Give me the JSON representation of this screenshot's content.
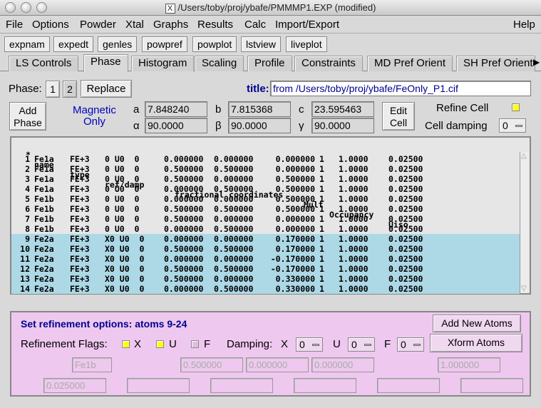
{
  "window": {
    "title": "/Users/toby/proj/ybafe/PMMMP1.EXP (modified)",
    "x_glyph": "X"
  },
  "menubar": {
    "items": [
      "File",
      "Options",
      "Powder",
      "Xtal",
      "Graphs",
      "Results",
      "Calc",
      "Import/Export"
    ],
    "help": "Help"
  },
  "commands": [
    "expnam",
    "expedt",
    "genles",
    "powpref",
    "powplot",
    "lstview",
    "liveplot"
  ],
  "tabs": [
    "LS Controls",
    "Phase",
    "Histogram",
    "Scaling",
    "Profile",
    "Constraints",
    "MD Pref Orient",
    "SH Pref Orient"
  ],
  "active_tab": "Phase",
  "phase": {
    "label": "Phase:",
    "buttons": [
      "1",
      "2"
    ],
    "replace": "Replace",
    "title_label": "title:",
    "title_value": "from /Users/toby/proj/ybafe/FeOnly_P1.cif",
    "add_phase": "Add\nPhase",
    "magnetic": "Magnetic\nOnly",
    "cell": {
      "a_label": "a",
      "a": "7.848240",
      "b_label": "b",
      "b": "7.815368",
      "c_label": "c",
      "c": "23.595463",
      "alpha_label": "α",
      "alpha": "90.0000",
      "beta_label": "β",
      "beta": "90.0000",
      "gamma_label": "γ",
      "gamma": "90.0000"
    },
    "edit_cell": "Edit\nCell",
    "refine_cell": "Refine Cell",
    "cell_damping": "Cell damping",
    "cell_damping_value": "0"
  },
  "atom_table": {
    "headers": {
      "star": "*",
      "name": "name",
      "type": "type",
      "ref": "ref/damp",
      "coords": "fractional coordinates",
      "mult": "Mult",
      "occ": "Occupancy",
      "uiso": "Uiso"
    },
    "rows": [
      {
        "n": "1",
        "name": "Fe1a",
        "type": "FE+3",
        "ref": "0 U0  0",
        "x": "0.000000",
        "y": "0.000000",
        "z": "0.000000",
        "mult": "1",
        "occ": "1.0000",
        "uiso": "0.02500",
        "sel": false
      },
      {
        "n": "2",
        "name": "Fe1a",
        "type": "FE+3",
        "ref": "0 U0  0",
        "x": "0.500000",
        "y": "0.500000",
        "z": "0.000000",
        "mult": "1",
        "occ": "1.0000",
        "uiso": "0.02500",
        "sel": false
      },
      {
        "n": "3",
        "name": "Fe1a",
        "type": "FE+3",
        "ref": "0 U0  0",
        "x": "0.500000",
        "y": "0.000000",
        "z": "0.500000",
        "mult": "1",
        "occ": "1.0000",
        "uiso": "0.02500",
        "sel": false
      },
      {
        "n": "4",
        "name": "Fe1a",
        "type": "FE+3",
        "ref": "0 U0  0",
        "x": "0.000000",
        "y": "0.500000",
        "z": "0.500000",
        "mult": "1",
        "occ": "1.0000",
        "uiso": "0.02500",
        "sel": false
      },
      {
        "n": "5",
        "name": "Fe1b",
        "type": "FE+3",
        "ref": "0 U0  0",
        "x": "0.000000",
        "y": "0.000000",
        "z": "0.500000",
        "mult": "1",
        "occ": "1.0000",
        "uiso": "0.02500",
        "sel": false
      },
      {
        "n": "6",
        "name": "Fe1b",
        "type": "FE+3",
        "ref": "0 U0  0",
        "x": "0.500000",
        "y": "0.500000",
        "z": "0.500000",
        "mult": "1",
        "occ": "1.0000",
        "uiso": "0.02500",
        "sel": false
      },
      {
        "n": "7",
        "name": "Fe1b",
        "type": "FE+3",
        "ref": "0 U0  0",
        "x": "0.500000",
        "y": "0.000000",
        "z": "0.000000",
        "mult": "1",
        "occ": "1.0000",
        "uiso": "0.02500",
        "sel": false
      },
      {
        "n": "8",
        "name": "Fe1b",
        "type": "FE+3",
        "ref": "0 U0  0",
        "x": "0.000000",
        "y": "0.500000",
        "z": "0.000000",
        "mult": "1",
        "occ": "1.0000",
        "uiso": "0.02500",
        "sel": false
      },
      {
        "n": "9",
        "name": "Fe2a",
        "type": "FE+3",
        "ref": "X0 U0  0",
        "x": "0.000000",
        "y": "0.000000",
        "z": "0.170000",
        "mult": "1",
        "occ": "1.0000",
        "uiso": "0.02500",
        "sel": true
      },
      {
        "n": "10",
        "name": "Fe2a",
        "type": "FE+3",
        "ref": "X0 U0  0",
        "x": "0.500000",
        "y": "0.500000",
        "z": "0.170000",
        "mult": "1",
        "occ": "1.0000",
        "uiso": "0.02500",
        "sel": true
      },
      {
        "n": "11",
        "name": "Fe2a",
        "type": "FE+3",
        "ref": "X0 U0  0",
        "x": "0.000000",
        "y": "0.000000",
        "z": "-0.170000",
        "mult": "1",
        "occ": "1.0000",
        "uiso": "0.02500",
        "sel": true
      },
      {
        "n": "12",
        "name": "Fe2a",
        "type": "FE+3",
        "ref": "X0 U0  0",
        "x": "0.500000",
        "y": "0.500000",
        "z": "-0.170000",
        "mult": "1",
        "occ": "1.0000",
        "uiso": "0.02500",
        "sel": true
      },
      {
        "n": "13",
        "name": "Fe2a",
        "type": "FE+3",
        "ref": "X0 U0  0",
        "x": "0.500000",
        "y": "0.000000",
        "z": "0.330000",
        "mult": "1",
        "occ": "1.0000",
        "uiso": "0.02500",
        "sel": true
      },
      {
        "n": "14",
        "name": "Fe2a",
        "type": "FE+3",
        "ref": "X0 U0  0",
        "x": "0.000000",
        "y": "0.500000",
        "z": "0.330000",
        "mult": "1",
        "occ": "1.0000",
        "uiso": "0.02500",
        "sel": true
      }
    ]
  },
  "refinement": {
    "title": "Set refinement options: atoms 9-24",
    "add_new_atoms": "Add New Atoms",
    "xform_atoms": "Xform Atoms",
    "flags_label": "Refinement Flags:",
    "flag_x": "X",
    "flag_u": "U",
    "flag_f": "F",
    "damping_label": "Damping:",
    "damp_x_label": "X",
    "damp_x": "0",
    "damp_u_label": "U",
    "damp_u": "0",
    "damp_f_label": "F",
    "damp_f": "0",
    "fields": {
      "name": "Fe1b",
      "x": "0.500000",
      "y": "0.000000",
      "z": "0.000000",
      "occ": "1.000000",
      "uiso": "0.025000"
    }
  },
  "colors": {
    "selected_row": "#add8e6",
    "panel": "#eec8ee",
    "checked": "#ffff00",
    "title_blue": "#000090"
  }
}
